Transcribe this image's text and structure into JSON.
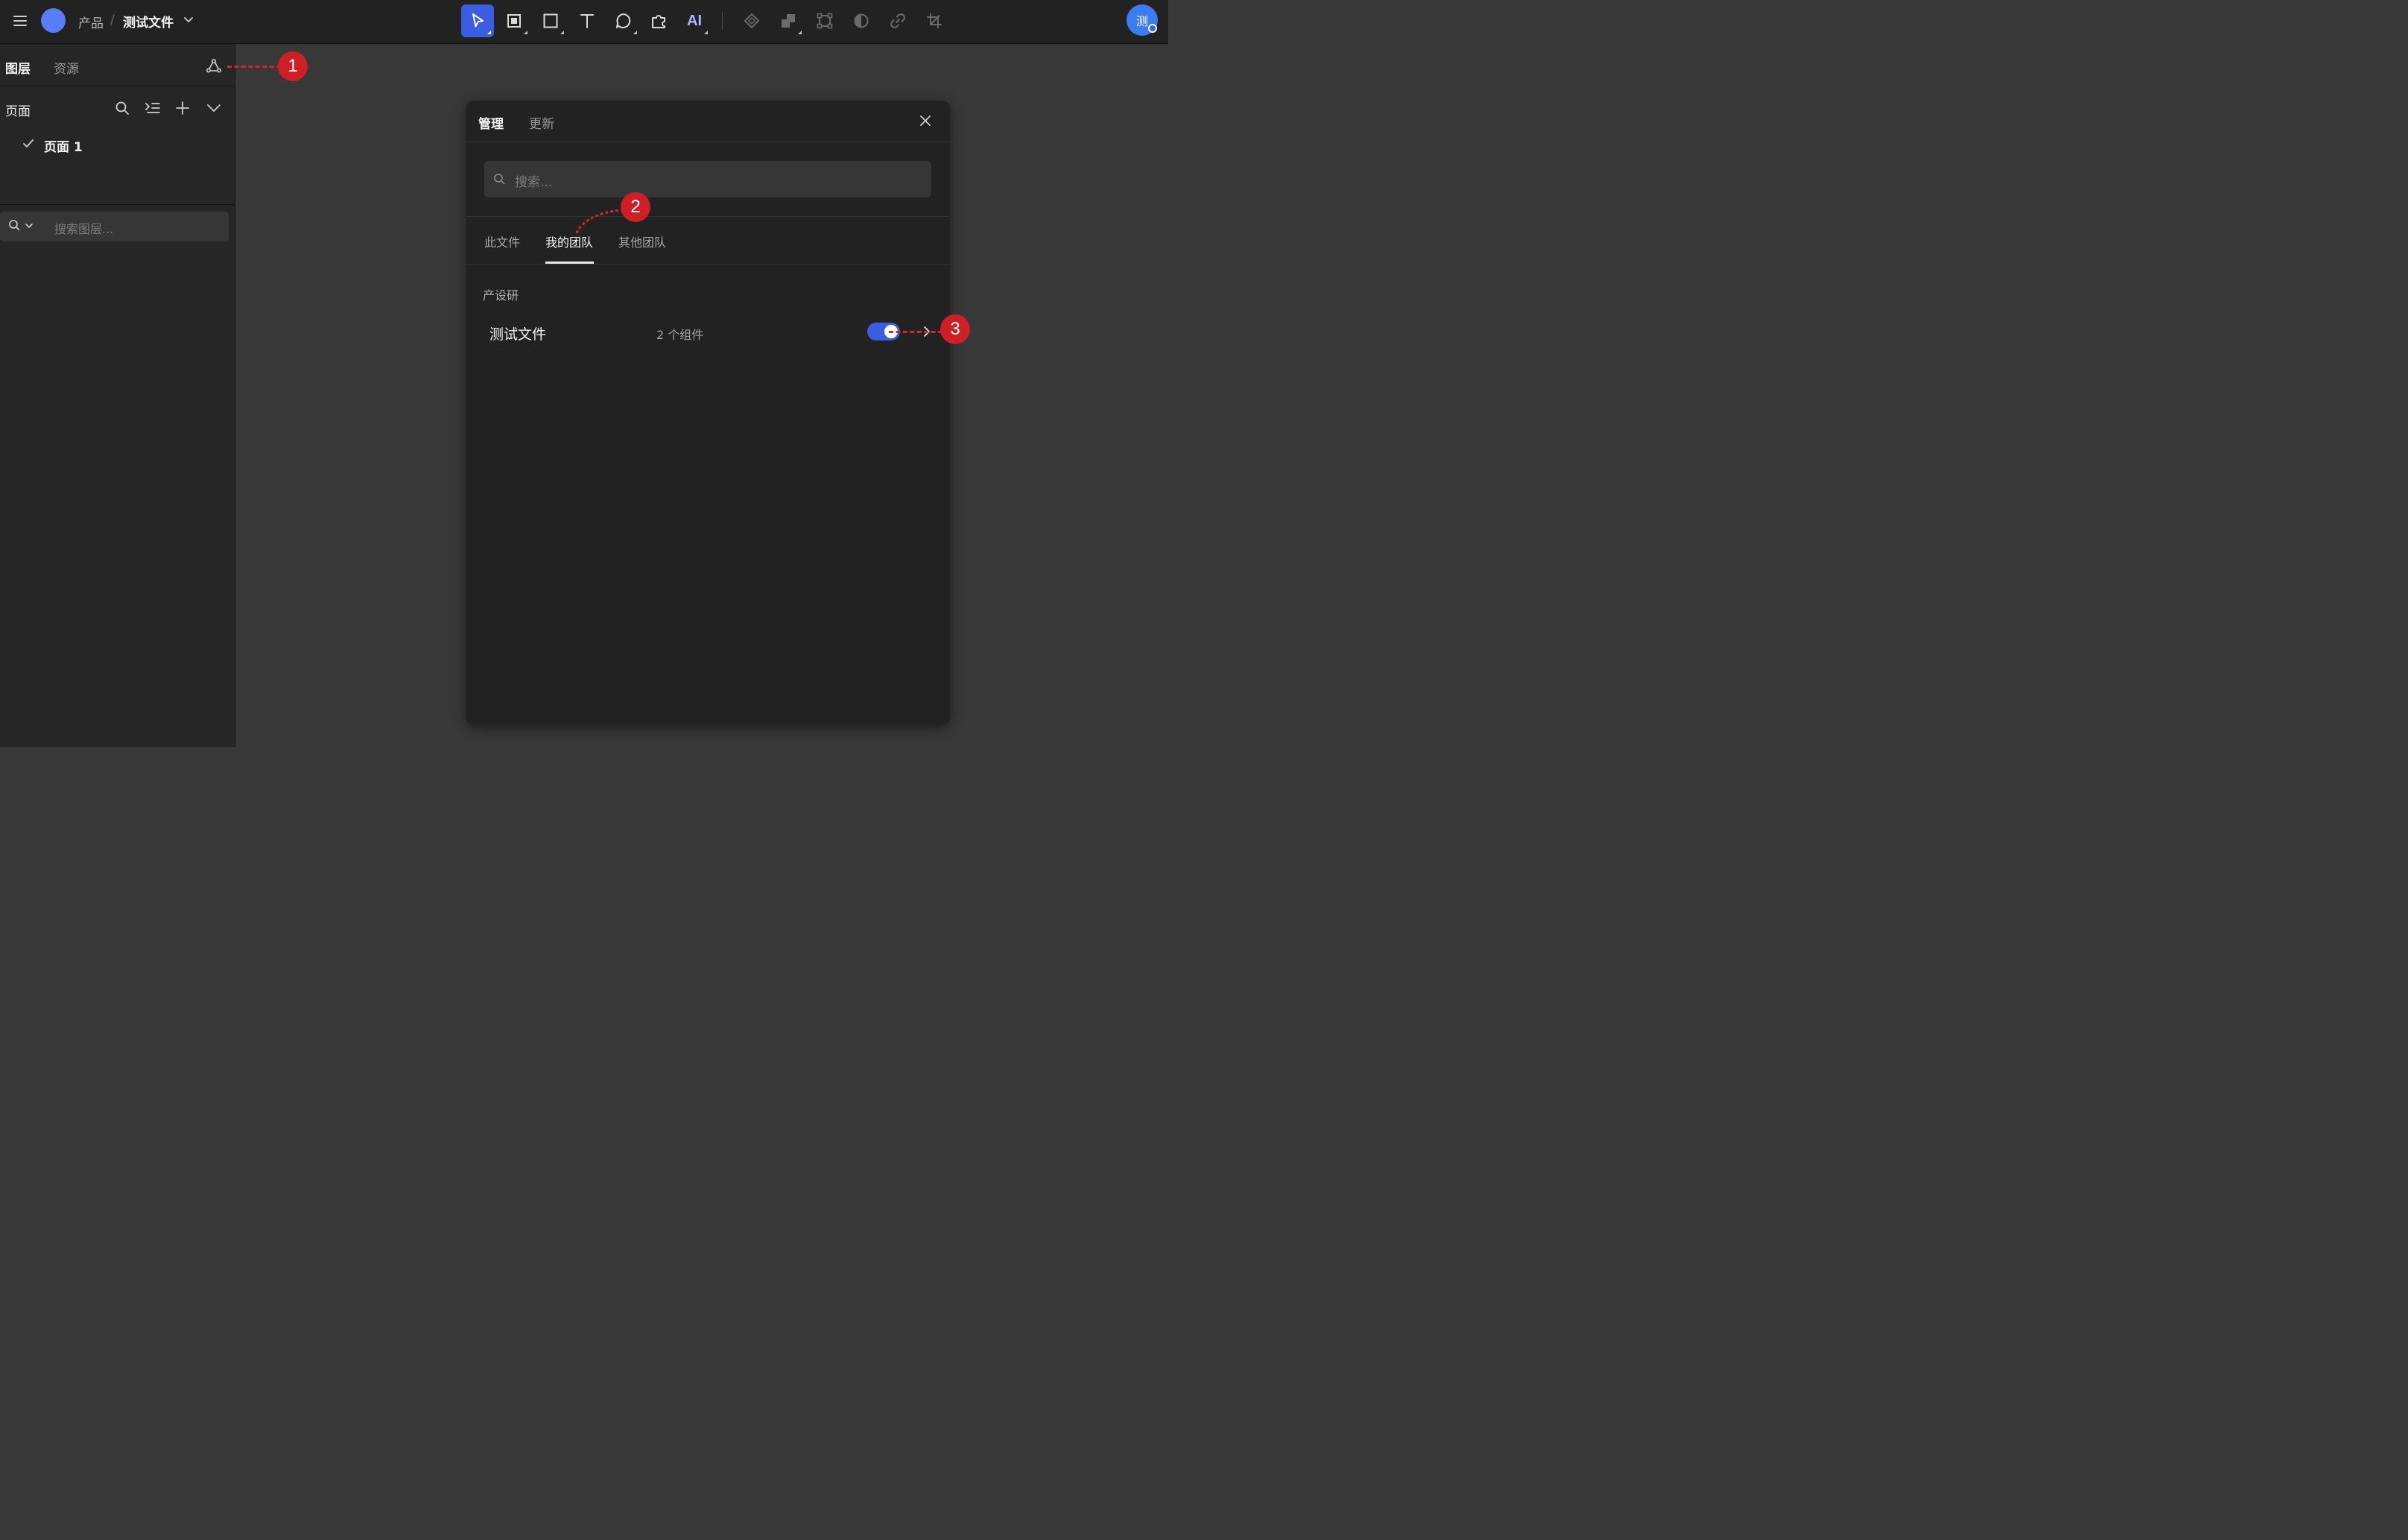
{
  "header": {
    "breadcrumb_product": "产品",
    "breadcrumb_sep": "/",
    "file_name": "测试文件",
    "ai_label": "AI",
    "avatar_initial": "测"
  },
  "toolbar": {
    "tools": [
      {
        "name": "move-tool",
        "active": true
      },
      {
        "name": "frame-tool",
        "active": false
      },
      {
        "name": "rectangle-tool",
        "active": false
      },
      {
        "name": "text-tool",
        "active": false
      },
      {
        "name": "comment-tool",
        "active": false
      },
      {
        "name": "plugin-tool",
        "active": false
      },
      {
        "name": "ai-tool",
        "active": false
      },
      {
        "name": "component-tool",
        "active": false
      },
      {
        "name": "boolean-tool",
        "active": false
      },
      {
        "name": "transform-tool",
        "active": false
      },
      {
        "name": "mask-tool",
        "active": false
      },
      {
        "name": "link-tool",
        "active": false
      },
      {
        "name": "crop-tool",
        "active": false
      }
    ]
  },
  "sidebar": {
    "tabs": [
      {
        "label": "图层",
        "active": true
      },
      {
        "label": "资源",
        "active": false
      }
    ],
    "pages_title": "页面",
    "pages": [
      {
        "label": "页面 1",
        "selected": true
      }
    ],
    "layer_search_placeholder": "搜索图层..."
  },
  "dialog": {
    "tabs": [
      {
        "label": "管理",
        "active": true
      },
      {
        "label": "更新",
        "active": false
      }
    ],
    "search_placeholder": "搜索...",
    "sub_tabs": [
      {
        "label": "此文件",
        "active": false
      },
      {
        "label": "我的团队",
        "active": true
      },
      {
        "label": "其他团队",
        "active": false
      }
    ],
    "group_name": "产设研",
    "library": {
      "name": "测试文件",
      "count": "2 个组件",
      "enabled": true
    }
  },
  "annotations": [
    "1",
    "2",
    "3"
  ],
  "colors": {
    "accent": "#3d5de0",
    "annotation": "#cd1f25",
    "team_dot": "#5b7cf7",
    "avatar": "#3d7bf0"
  }
}
